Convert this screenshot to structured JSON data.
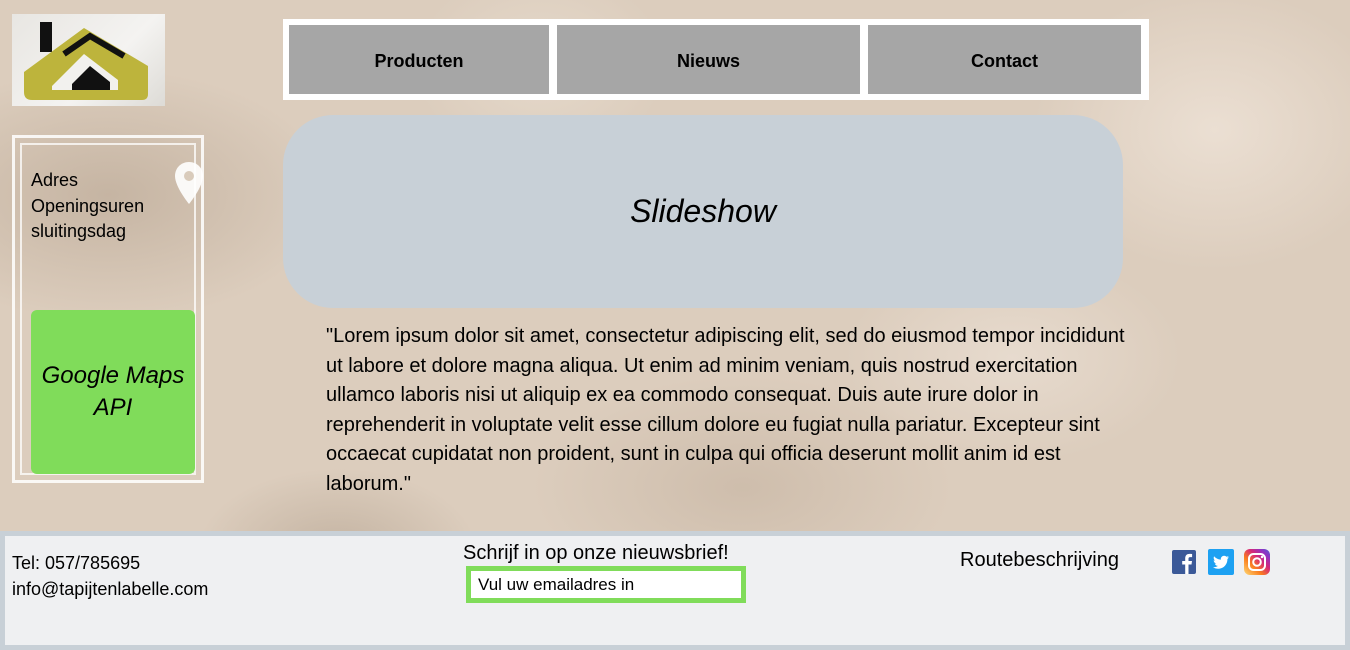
{
  "nav": {
    "items": [
      {
        "label": "Producten"
      },
      {
        "label": "Nieuws"
      },
      {
        "label": "Contact"
      }
    ]
  },
  "sidebar": {
    "address_label": "Adres",
    "hours_label": "Openingsuren",
    "closing_label": "sluitingsdag",
    "maps_placeholder": "Google Maps API"
  },
  "main": {
    "slideshow_label": "Slideshow",
    "lorem": "\"Lorem ipsum dolor sit amet, consectetur adipiscing elit, sed do eiusmod tempor incididunt ut labore et dolore magna aliqua. Ut enim ad minim veniam, quis nostrud exercitation ullamco laboris nisi ut aliquip ex ea commodo consequat. Duis aute irure dolor in reprehenderit in voluptate velit esse cillum dolore eu fugiat nulla pariatur. Excepteur sint occaecat cupidatat non proident, sunt in culpa qui officia deserunt mollit anim id est laborum.\""
  },
  "footer": {
    "phone": "Tel: 057/785695",
    "email": "info@tapijtenlabelle.com",
    "newsletter_title": "Schrijf in op onze nieuwsbrief!",
    "newsletter_placeholder": "Vul uw emailadres in",
    "route_label": "Routebeschrijving",
    "social": [
      "facebook-icon",
      "twitter-icon",
      "instagram-icon"
    ]
  },
  "colors": {
    "nav_button": "#a6a6a6",
    "maps_green": "#80dc5a",
    "slideshow_bg": "#c8d0d7",
    "footer_bg": "#eff0f2",
    "logo_gold": "#bdb43c"
  },
  "icons": {
    "logo": "house-logo-icon",
    "pin": "map-pin-icon"
  }
}
